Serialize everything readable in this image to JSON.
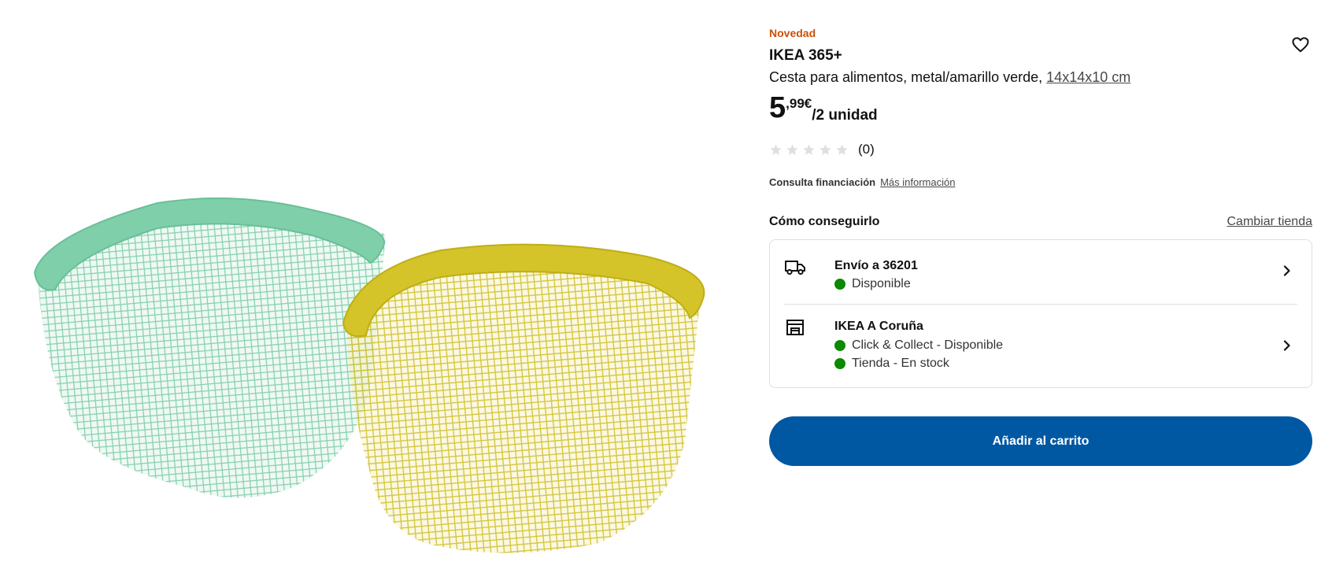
{
  "product": {
    "badge": "Novedad",
    "name": "IKEA 365+",
    "description": "Cesta para alimentos, metal/amarillo verde,",
    "size_link": "14x14x10 cm",
    "price_int": "5",
    "price_dec": ",99€",
    "price_unit": "/2 unidad",
    "rating_count": "(0)",
    "rating_value": 0,
    "rating_max": 5,
    "favorite_icon": "heart-icon"
  },
  "financing": {
    "label": "Consulta financiación",
    "link": "Más información"
  },
  "availability": {
    "title": "Cómo conseguirlo",
    "change_store": "Cambiar tienda",
    "delivery": {
      "icon": "truck-icon",
      "title": "Envío a 36201",
      "status": "Disponible"
    },
    "store": {
      "icon": "store-icon",
      "title": "IKEA A Coruña",
      "click_collect": "Click & Collect - Disponible",
      "in_store": "Tienda - En stock"
    }
  },
  "cart": {
    "button_label": "Añadir al carrito"
  },
  "colors": {
    "badge": "#ca5008",
    "primary_button": "#0058a3",
    "available_dot": "#0a8a00",
    "basket_green": "#7fcfaa",
    "basket_yellow": "#d4c42a"
  }
}
